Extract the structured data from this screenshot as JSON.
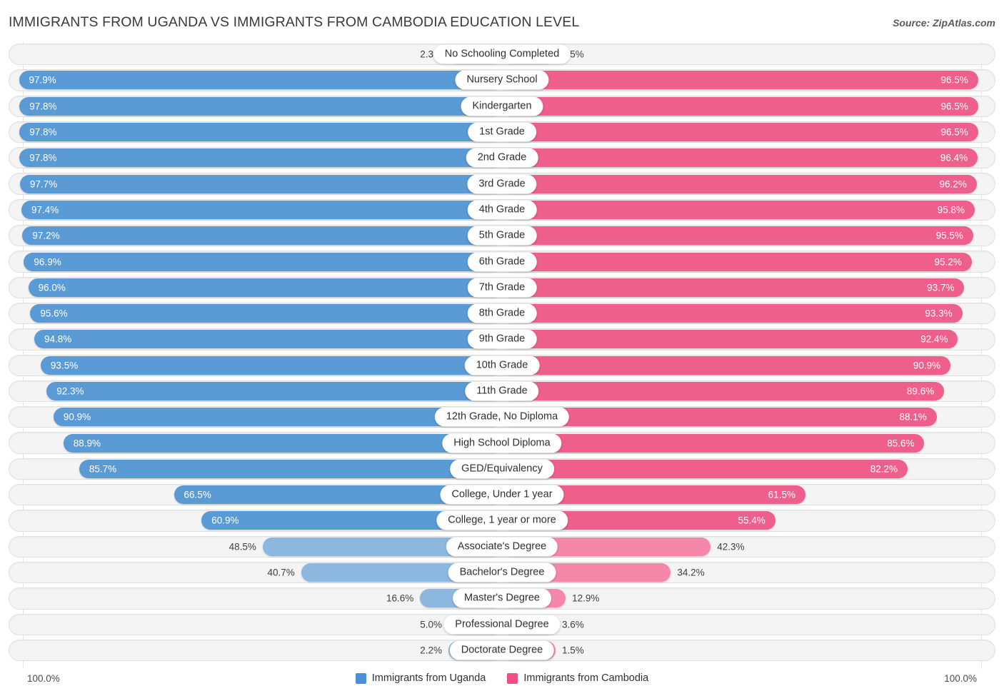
{
  "header": {
    "title": "IMMIGRANTS FROM UGANDA VS IMMIGRANTS FROM CAMBODIA EDUCATION LEVEL",
    "source": "Source: ZipAtlas.com"
  },
  "footer": {
    "axis_left": "100.0%",
    "axis_right": "100.0%",
    "legend": [
      {
        "label": "Immigrants from Uganda",
        "color": "#4a90d9"
      },
      {
        "label": "Immigrants from Cambodia",
        "color": "#ee4f85"
      }
    ]
  },
  "colors": {
    "left_strong": "#5b9bd5",
    "left_soft": "#8cb8e0",
    "right_strong": "#ef5f8c",
    "right_soft": "#f587ab",
    "track": "#f4f4f4"
  },
  "chart_data": {
    "type": "bar",
    "title": "IMMIGRANTS FROM UGANDA VS IMMIGRANTS FROM CAMBODIA EDUCATION LEVEL",
    "subtitle": "",
    "xlabel": "",
    "ylabel": "",
    "orientation": "horizontal",
    "layout": "diverging-bidirectional",
    "grid": false,
    "legend_position": "bottom-center",
    "xlim": [
      0,
      100
    ],
    "axis_unit": "%",
    "categories": [
      "No Schooling Completed",
      "Nursery School",
      "Kindergarten",
      "1st Grade",
      "2nd Grade",
      "3rd Grade",
      "4th Grade",
      "5th Grade",
      "6th Grade",
      "7th Grade",
      "8th Grade",
      "9th Grade",
      "10th Grade",
      "11th Grade",
      "12th Grade, No Diploma",
      "High School Diploma",
      "GED/Equivalency",
      "College, Under 1 year",
      "College, 1 year or more",
      "Associate's Degree",
      "Bachelor's Degree",
      "Master's Degree",
      "Professional Degree",
      "Doctorate Degree"
    ],
    "series": [
      {
        "name": "Immigrants from Uganda",
        "color": "#4a90d9",
        "side": "left",
        "values": [
          2.3,
          97.9,
          97.8,
          97.8,
          97.8,
          97.7,
          97.4,
          97.2,
          96.9,
          96.0,
          95.6,
          94.8,
          93.5,
          92.3,
          90.9,
          88.9,
          85.7,
          66.5,
          60.9,
          48.5,
          40.7,
          16.6,
          5.0,
          2.2
        ],
        "labels": [
          "2.3%",
          "97.9%",
          "97.8%",
          "97.8%",
          "97.8%",
          "97.7%",
          "97.4%",
          "97.2%",
          "96.9%",
          "96.0%",
          "95.6%",
          "94.8%",
          "93.5%",
          "92.3%",
          "90.9%",
          "88.9%",
          "85.7%",
          "66.5%",
          "60.9%",
          "48.5%",
          "40.7%",
          "16.6%",
          "5.0%",
          "2.2%"
        ]
      },
      {
        "name": "Immigrants from Cambodia",
        "color": "#ee4f85",
        "side": "right",
        "values": [
          3.5,
          96.5,
          96.5,
          96.5,
          96.4,
          96.2,
          95.8,
          95.5,
          95.2,
          93.7,
          93.3,
          92.4,
          90.9,
          89.6,
          88.1,
          85.6,
          82.2,
          61.5,
          55.4,
          42.3,
          34.2,
          12.9,
          3.6,
          1.5
        ],
        "labels": [
          "3.5%",
          "96.5%",
          "96.5%",
          "96.5%",
          "96.4%",
          "96.2%",
          "95.8%",
          "95.5%",
          "95.2%",
          "93.7%",
          "93.3%",
          "92.4%",
          "90.9%",
          "89.6%",
          "88.1%",
          "85.6%",
          "82.2%",
          "61.5%",
          "55.4%",
          "42.3%",
          "34.2%",
          "12.9%",
          "3.6%",
          "1.5%"
        ]
      }
    ]
  }
}
